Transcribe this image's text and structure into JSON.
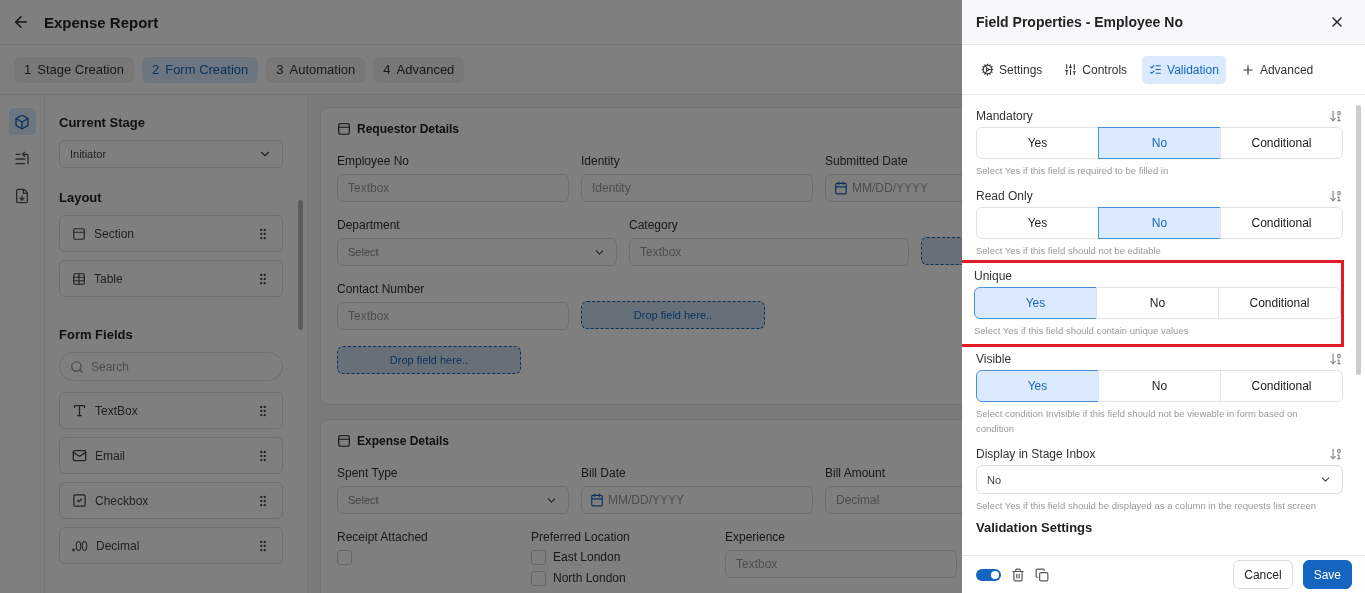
{
  "header": {
    "title": "Expense Report"
  },
  "steps": [
    {
      "number": "1",
      "label": "Stage Creation",
      "selected": false
    },
    {
      "number": "2",
      "label": "Form Creation",
      "selected": true
    },
    {
      "number": "3",
      "label": "Automation",
      "selected": false
    },
    {
      "number": "4",
      "label": "Advanced",
      "selected": false
    }
  ],
  "rail": [
    {
      "kind": "cube",
      "selected": true
    },
    {
      "kind": "list",
      "selected": false
    },
    {
      "kind": "form",
      "selected": false
    }
  ],
  "left_panel": {
    "stage_title": "Current Stage",
    "stage_value": "Initiator",
    "layout_title": "Layout",
    "layout_items": [
      {
        "kind": "section",
        "label": "Section"
      },
      {
        "kind": "table",
        "label": "Table"
      }
    ],
    "fields_title": "Form Fields",
    "search_placeholder": "Search",
    "field_items": [
      {
        "kind": "text",
        "label": "TextBox"
      },
      {
        "kind": "email",
        "label": "Email"
      },
      {
        "kind": "checkbox",
        "label": "Checkbox"
      },
      {
        "kind": "decimal",
        "label": "Decimal"
      }
    ]
  },
  "sections": [
    {
      "title": "Requestor Details",
      "rows": [
        [
          {
            "kind": "text",
            "label": "Employee No",
            "placeholder": "Textbox"
          },
          {
            "kind": "text",
            "label": "Identity",
            "placeholder": "Identity"
          },
          {
            "kind": "date",
            "label": "Submitted Date",
            "placeholder": "MM/DD/YYYY"
          }
        ],
        [
          {
            "kind": "select",
            "label": "Department",
            "placeholder": "Select"
          },
          {
            "kind": "text",
            "label": "Category",
            "placeholder": "Textbox"
          },
          {
            "kind": "drop"
          }
        ],
        [
          {
            "kind": "text",
            "label": "Contact Number",
            "placeholder": "Textbox"
          },
          {
            "kind": "drop",
            "text": "Drop field here.."
          }
        ],
        [
          {
            "kind": "drop",
            "text": "Drop field here.."
          }
        ]
      ]
    },
    {
      "title": "Expense Details",
      "rows": [
        [
          {
            "kind": "select",
            "label": "Spent Type",
            "placeholder": "Select"
          },
          {
            "kind": "date",
            "label": "Bill Date",
            "placeholder": "MM/DD/YYYY"
          },
          {
            "kind": "text",
            "label": "Bill Amount",
            "placeholder": "Decimal"
          }
        ],
        [
          {
            "kind": "checkbox",
            "label": "Receipt Attached",
            "checked": false
          },
          {
            "kind": "options",
            "label": "Preferred Location",
            "options": [
              {
                "label": "East London",
                "checked": false
              },
              {
                "label": "North London",
                "checked": false
              }
            ]
          },
          {
            "kind": "text",
            "label": "Experience",
            "placeholder": "Textbox"
          }
        ]
      ]
    }
  ],
  "drawer": {
    "title": "Field Properties - Employee No",
    "tabs": [
      {
        "kind": "settings",
        "label": "Settings",
        "selected": false
      },
      {
        "kind": "controls",
        "label": "Controls",
        "selected": false
      },
      {
        "kind": "validation",
        "label": "Validation",
        "selected": true
      },
      {
        "kind": "advanced",
        "label": "Advanced",
        "selected": false
      }
    ],
    "settings": [
      {
        "label": "Mandatory",
        "highlighted": false,
        "options": [
          {
            "label": "Yes",
            "selected": false
          },
          {
            "label": "No",
            "selected": true
          },
          {
            "label": "Conditional",
            "selected": false
          }
        ],
        "hint": "Select Yes if this field is required to be filled in"
      },
      {
        "label": "Read Only",
        "highlighted": false,
        "options": [
          {
            "label": "Yes",
            "selected": false
          },
          {
            "label": "No",
            "selected": true
          },
          {
            "label": "Conditional",
            "selected": false
          }
        ],
        "hint": "Select Yes if this field should not be editable"
      },
      {
        "label": "Unique",
        "highlighted": true,
        "options": [
          {
            "label": "Yes",
            "selected": true
          },
          {
            "label": "No",
            "selected": false
          },
          {
            "label": "Conditional",
            "selected": false
          }
        ],
        "hint": "Select Yes if this field should contain unique values"
      },
      {
        "label": "Visible",
        "highlighted": false,
        "options": [
          {
            "label": "Yes",
            "selected": true
          },
          {
            "label": "No",
            "selected": false
          },
          {
            "label": "Conditional",
            "selected": false
          }
        ],
        "hint": "Select condition Invisible if this field should not be viewable in form based on condition"
      }
    ],
    "inbox": {
      "label": "Display in Stage Inbox",
      "value": "No",
      "hint": "Select Yes if this field should be displayed as a column in the requests list screen"
    },
    "next_heading": "Validation Settings",
    "footer": {
      "enabled": true,
      "cancel": "Cancel",
      "save": "Save"
    }
  }
}
